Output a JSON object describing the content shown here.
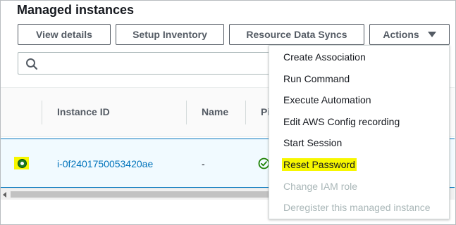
{
  "page": {
    "title": "Managed instances"
  },
  "toolbar": {
    "view_details": "View details",
    "setup_inventory": "Setup Inventory",
    "resource_data_syncs": "Resource Data Syncs",
    "actions": "Actions"
  },
  "search": {
    "icon": "search-icon",
    "value": ""
  },
  "table": {
    "columns": [
      "Instance ID",
      "Name",
      "Pi"
    ],
    "rows": [
      {
        "selected": true,
        "instance_id": "i-0f2401750053420ae",
        "name": "-",
        "status_icon": "check-circle-icon"
      }
    ]
  },
  "actions_menu": {
    "items": [
      {
        "label": "Create Association",
        "enabled": true
      },
      {
        "label": "Run Command",
        "enabled": true
      },
      {
        "label": "Execute Automation",
        "enabled": true
      },
      {
        "label": "Edit AWS Config recording",
        "enabled": true
      },
      {
        "label": "Start Session",
        "enabled": true
      },
      {
        "label": "Reset Password",
        "enabled": true,
        "highlighted": true
      },
      {
        "label": "Change IAM role",
        "enabled": false
      },
      {
        "label": "Deregister this managed instance",
        "enabled": false
      }
    ]
  },
  "colors": {
    "link": "#0073bb",
    "highlight": "#f7f700",
    "selected_row_bg": "#f1faff",
    "radio_selected": "#1d7a24",
    "success": "#1d8102",
    "disabled_text": "#aab7b8"
  }
}
